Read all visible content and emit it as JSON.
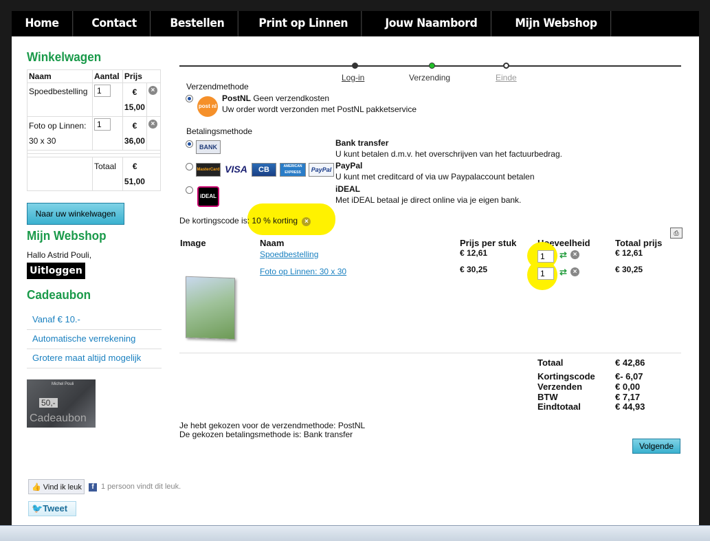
{
  "nav": [
    "Home",
    "Contact",
    "Bestellen",
    "Print op Linnen",
    "Jouw Naambord",
    "Mijn Webshop"
  ],
  "cart": {
    "title": "Winkelwagen",
    "headers": [
      "Naam",
      "Aantal",
      "Prijs"
    ],
    "items": [
      {
        "name": "Spoedbestelling",
        "qty": "1",
        "currency": "€",
        "price": "15,00"
      },
      {
        "name": "Foto op Linnen: 30 x 30",
        "qty": "1",
        "currency": "€",
        "price": "36,00"
      }
    ],
    "total_label": "Totaal",
    "total_currency": "€",
    "total": "51,00",
    "button": "Naar uw winkelwagen"
  },
  "webshop": {
    "title": "Mijn Webshop",
    "greeting": "Hallo Astrid Pouli,",
    "logout": "Uitloggen"
  },
  "gift": {
    "title": "Cadeaubon",
    "items": [
      "Vanaf € 10.-",
      "Automatische verrekening",
      "Grotere maat altijd mogelijk"
    ],
    "image_top": "Michel Pouli",
    "image_value": "50,-",
    "image_caption": "Cadeaubon"
  },
  "social": {
    "like": "Vind ik leuk",
    "like_count": "1 persoon vindt dit leuk.",
    "tweet": "Tweet"
  },
  "steps": [
    "Log-in",
    "Verzending",
    "Einde"
  ],
  "shipping": {
    "label": "Verzendmethode",
    "name": "PostNL",
    "note": "Geen verzendkosten",
    "desc": "Uw order wordt verzonden met PostNL pakketservice",
    "logo": "post nl"
  },
  "payment": {
    "label": "Betalingsmethode",
    "options": [
      {
        "name": "Bank transfer",
        "desc": "U kunt betalen d.m.v. het overschrijven van het factuurbedrag.",
        "logo": "BANK"
      },
      {
        "name": "PayPal",
        "desc": "U kunt met creditcard of via uw Paypalaccount betalen",
        "logos": [
          "MasterCard",
          "VISA",
          "CB",
          "AMERICAN EXPRESS",
          "PayPal"
        ]
      },
      {
        "name": "iDEAL",
        "desc": "Met iDEAL betaal je direct online via je eigen bank.",
        "logo": "iDEAL"
      }
    ]
  },
  "discount": {
    "label": "De kortingscode is:",
    "value": "10 % korting"
  },
  "order": {
    "headers": [
      "Image",
      "Naam",
      "Prijs per stuk",
      "Hoeveelheid",
      "Totaal prijs"
    ],
    "rows": [
      {
        "name": "Spoedbestelling",
        "unit": "€ 12,61",
        "qty": "1",
        "total": "€ 12,61"
      },
      {
        "name": "Foto op Linnen: 30 x 30",
        "unit": "€ 30,25",
        "qty": "1",
        "total": "€ 30,25"
      }
    ]
  },
  "summary": {
    "totaal_label": "Totaal",
    "totaal": "€ 42,86",
    "rows": [
      {
        "label": "Kortingscode",
        "value": "€- 6,07"
      },
      {
        "label": "Verzenden",
        "value": "€ 0,00"
      },
      {
        "label": "BTW",
        "value": "€ 7,17"
      },
      {
        "label": "Eindtotaal",
        "value": "€ 44,93"
      }
    ]
  },
  "chosen": {
    "shipping": "Je hebt gekozen voor de verzendmethode: PostNL",
    "payment": "De gekozen betalingsmethode is: Bank transfer"
  },
  "next_button": "Volgende",
  "colors": {
    "accent_green": "#1a9a4a",
    "link_blue": "#1a80c0",
    "highlight": "#fff200"
  }
}
